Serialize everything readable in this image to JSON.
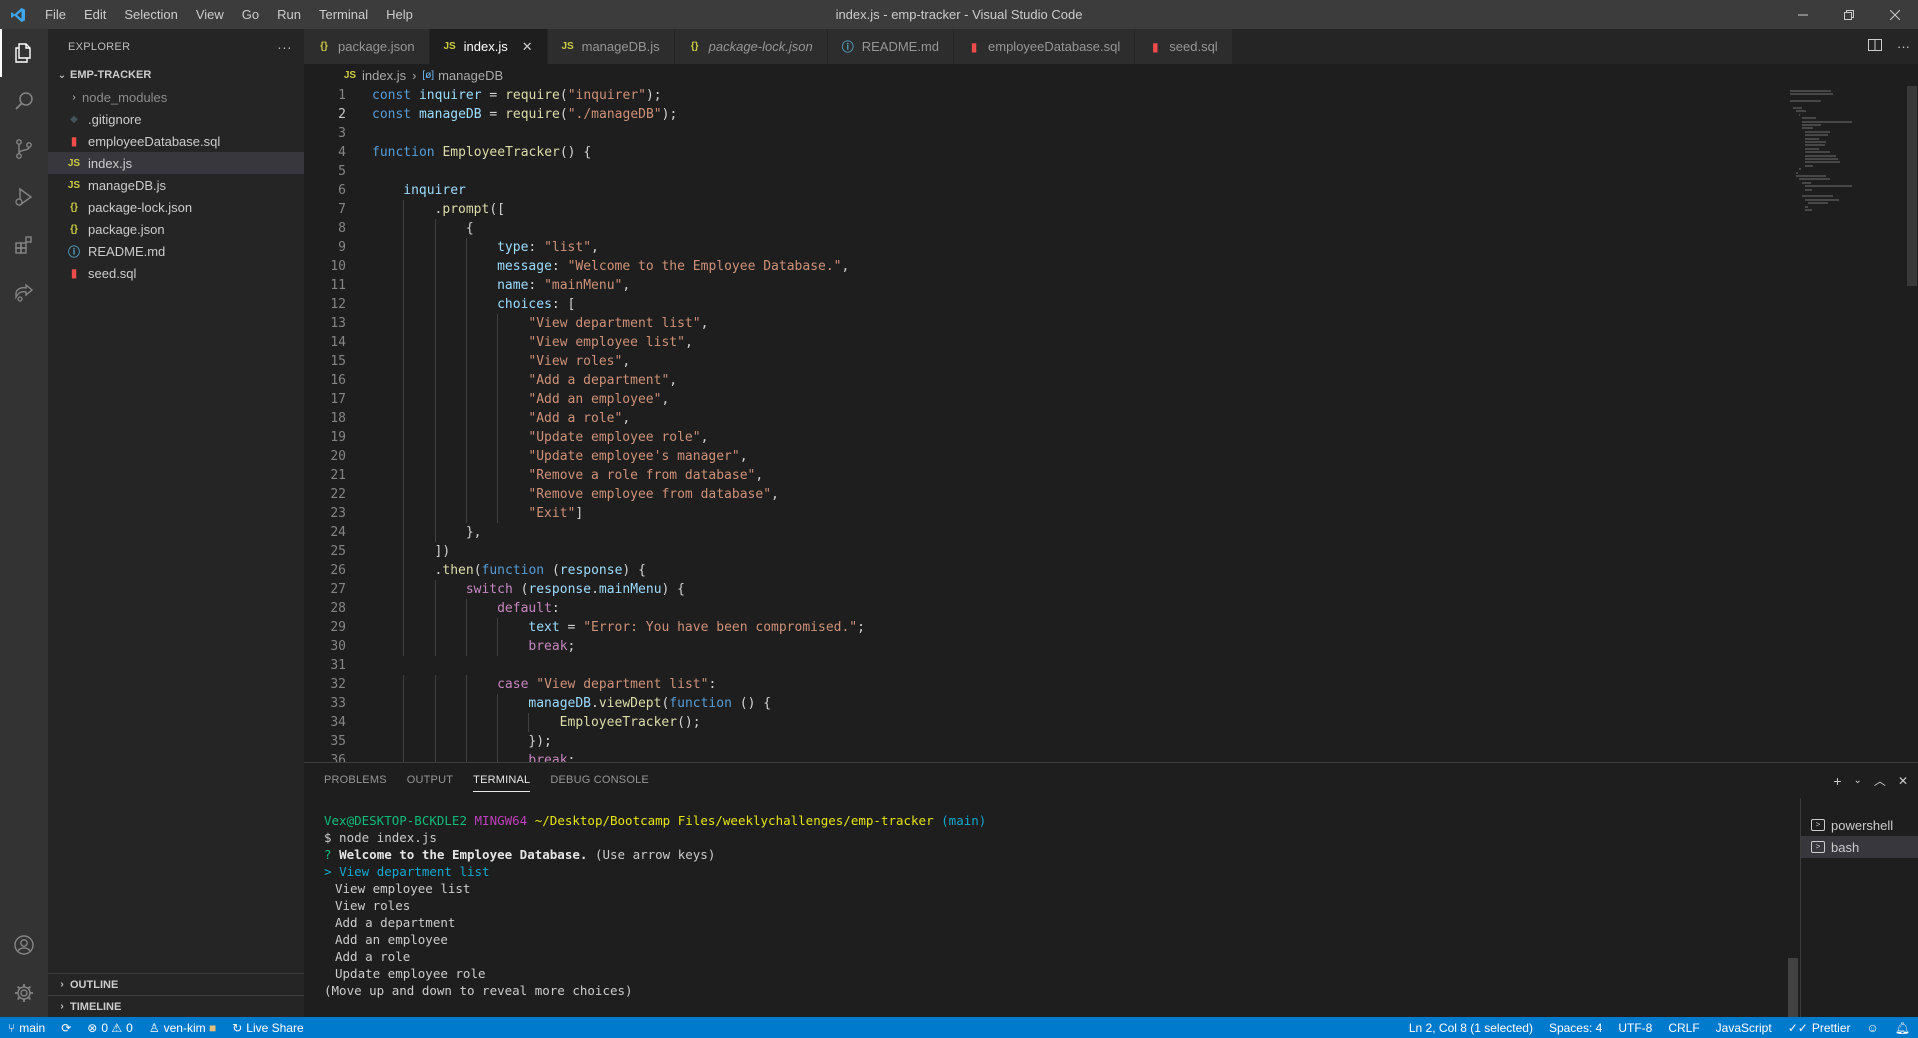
{
  "window": {
    "title": "index.js - emp-tracker - Visual Studio Code",
    "menu": [
      "File",
      "Edit",
      "Selection",
      "View",
      "Go",
      "Run",
      "Terminal",
      "Help"
    ]
  },
  "sidebar": {
    "header": "EXPLORER",
    "project": "EMP-TRACKER",
    "files": [
      {
        "name": "node_modules",
        "icon": "folder-icon"
      },
      {
        "name": ".gitignore",
        "icon": "git-icon"
      },
      {
        "name": "employeeDatabase.sql",
        "icon": "database-icon"
      },
      {
        "name": "index.js",
        "icon": "js-file-icon"
      },
      {
        "name": "manageDB.js",
        "icon": "js-file-icon"
      },
      {
        "name": "package-lock.json",
        "icon": "json-file-icon"
      },
      {
        "name": "package.json",
        "icon": "json-file-icon"
      },
      {
        "name": "README.md",
        "icon": "info-icon"
      },
      {
        "name": "seed.sql",
        "icon": "database-icon"
      }
    ],
    "outline": "OUTLINE",
    "timeline": "TIMELINE"
  },
  "tabs": [
    {
      "label": "package.json",
      "type": "json"
    },
    {
      "label": "index.js",
      "type": "js",
      "active": true
    },
    {
      "label": "manageDB.js",
      "type": "js"
    },
    {
      "label": "package-lock.json",
      "type": "json"
    },
    {
      "label": "README.md",
      "type": "info"
    },
    {
      "label": "employeeDatabase.sql",
      "type": "sql"
    },
    {
      "label": "seed.sql",
      "type": "sql"
    }
  ],
  "breadcrumb": {
    "file": "index.js",
    "symbol": "manageDB"
  },
  "editor": {
    "current_line": 2,
    "lines": [
      {
        "n": "1",
        "ind": 0,
        "toks": [
          [
            "kw",
            "const "
          ],
          [
            "var",
            "inquirer"
          ],
          [
            "pl",
            " = "
          ],
          [
            "fn",
            "require"
          ],
          [
            "pl",
            "("
          ],
          [
            "str",
            "\"inquirer\""
          ],
          [
            "pl",
            ");"
          ]
        ]
      },
      {
        "n": "2",
        "ind": 0,
        "toks": [
          [
            "kw",
            "const "
          ],
          [
            "var",
            "manageDB"
          ],
          [
            "pl",
            " = "
          ],
          [
            "fn",
            "require"
          ],
          [
            "pl",
            "("
          ],
          [
            "str",
            "\"./manageDB\""
          ],
          [
            "pl",
            ");"
          ]
        ]
      },
      {
        "n": "3",
        "ind": 0,
        "toks": []
      },
      {
        "n": "4",
        "ind": 0,
        "toks": [
          [
            "kw",
            "function "
          ],
          [
            "fn",
            "EmployeeTracker"
          ],
          [
            "pl",
            "() {"
          ]
        ]
      },
      {
        "n": "5",
        "ind": 0,
        "toks": []
      },
      {
        "n": "6",
        "ind": 1,
        "toks": [
          [
            "var",
            "inquirer"
          ]
        ]
      },
      {
        "n": "7",
        "ind": 2,
        "toks": [
          [
            "pl",
            "."
          ],
          [
            "fn",
            "prompt"
          ],
          [
            "pl",
            "(["
          ]
        ]
      },
      {
        "n": "8",
        "ind": 3,
        "toks": [
          [
            "pl",
            "{"
          ]
        ]
      },
      {
        "n": "9",
        "ind": 4,
        "toks": [
          [
            "var",
            "type"
          ],
          [
            "pl",
            ": "
          ],
          [
            "str",
            "\"list\""
          ],
          [
            "pl",
            ","
          ]
        ]
      },
      {
        "n": "10",
        "ind": 4,
        "toks": [
          [
            "var",
            "message"
          ],
          [
            "pl",
            ": "
          ],
          [
            "str",
            "\"Welcome to the Employee Database.\""
          ],
          [
            "pl",
            ","
          ]
        ]
      },
      {
        "n": "11",
        "ind": 4,
        "toks": [
          [
            "var",
            "name"
          ],
          [
            "pl",
            ": "
          ],
          [
            "str",
            "\"mainMenu\""
          ],
          [
            "pl",
            ","
          ]
        ]
      },
      {
        "n": "12",
        "ind": 4,
        "toks": [
          [
            "var",
            "choices"
          ],
          [
            "pl",
            ": ["
          ]
        ]
      },
      {
        "n": "13",
        "ind": 5,
        "toks": [
          [
            "str",
            "\"View department list\""
          ],
          [
            "pl",
            ","
          ]
        ]
      },
      {
        "n": "14",
        "ind": 5,
        "toks": [
          [
            "str",
            "\"View employee list\""
          ],
          [
            "pl",
            ","
          ]
        ]
      },
      {
        "n": "15",
        "ind": 5,
        "toks": [
          [
            "str",
            "\"View roles\""
          ],
          [
            "pl",
            ","
          ]
        ]
      },
      {
        "n": "16",
        "ind": 5,
        "toks": [
          [
            "str",
            "\"Add a department\""
          ],
          [
            "pl",
            ","
          ]
        ]
      },
      {
        "n": "17",
        "ind": 5,
        "toks": [
          [
            "str",
            "\"Add an employee\""
          ],
          [
            "pl",
            ","
          ]
        ]
      },
      {
        "n": "18",
        "ind": 5,
        "toks": [
          [
            "str",
            "\"Add a role\""
          ],
          [
            "pl",
            ","
          ]
        ]
      },
      {
        "n": "19",
        "ind": 5,
        "toks": [
          [
            "str",
            "\"Update employee role\""
          ],
          [
            "pl",
            ","
          ]
        ]
      },
      {
        "n": "20",
        "ind": 5,
        "toks": [
          [
            "str",
            "\"Update employee's manager\""
          ],
          [
            "pl",
            ","
          ]
        ]
      },
      {
        "n": "21",
        "ind": 5,
        "toks": [
          [
            "str",
            "\"Remove a role from database\""
          ],
          [
            "pl",
            ","
          ]
        ]
      },
      {
        "n": "22",
        "ind": 5,
        "toks": [
          [
            "str",
            "\"Remove employee from database\""
          ],
          [
            "pl",
            ","
          ]
        ]
      },
      {
        "n": "23",
        "ind": 5,
        "toks": [
          [
            "str",
            "\"Exit\""
          ],
          [
            "pl",
            "]"
          ]
        ]
      },
      {
        "n": "24",
        "ind": 3,
        "toks": [
          [
            "pl",
            "},"
          ]
        ]
      },
      {
        "n": "25",
        "ind": 2,
        "toks": [
          [
            "pl",
            "])"
          ]
        ]
      },
      {
        "n": "26",
        "ind": 2,
        "toks": [
          [
            "pl",
            "."
          ],
          [
            "fn",
            "then"
          ],
          [
            "pl",
            "("
          ],
          [
            "kw",
            "function "
          ],
          [
            "pl",
            "("
          ],
          [
            "var",
            "response"
          ],
          [
            "pl",
            ") {"
          ]
        ]
      },
      {
        "n": "27",
        "ind": 3,
        "toks": [
          [
            "kw2",
            "switch "
          ],
          [
            "pl",
            "("
          ],
          [
            "var",
            "response"
          ],
          [
            "pl",
            "."
          ],
          [
            "var",
            "mainMenu"
          ],
          [
            "pl",
            ") {"
          ]
        ]
      },
      {
        "n": "28",
        "ind": 4,
        "toks": [
          [
            "kw2",
            "default"
          ],
          [
            "pl",
            ":"
          ]
        ]
      },
      {
        "n": "29",
        "ind": 5,
        "toks": [
          [
            "var",
            "text"
          ],
          [
            "pl",
            " = "
          ],
          [
            "str",
            "\"Error: You have been compromised.\""
          ],
          [
            "pl",
            ";"
          ]
        ]
      },
      {
        "n": "30",
        "ind": 5,
        "toks": [
          [
            "kw2",
            "break"
          ],
          [
            "pl",
            ";"
          ]
        ]
      },
      {
        "n": "31",
        "ind": 0,
        "toks": []
      },
      {
        "n": "32",
        "ind": 4,
        "toks": [
          [
            "kw2",
            "case "
          ],
          [
            "str",
            "\"View department list\""
          ],
          [
            "pl",
            ":"
          ]
        ]
      },
      {
        "n": "33",
        "ind": 5,
        "toks": [
          [
            "var",
            "manageDB"
          ],
          [
            "pl",
            "."
          ],
          [
            "fn",
            "viewDept"
          ],
          [
            "pl",
            "("
          ],
          [
            "kw",
            "function "
          ],
          [
            "pl",
            "() {"
          ]
        ]
      },
      {
        "n": "34",
        "ind": 6,
        "toks": [
          [
            "fn",
            "EmployeeTracker"
          ],
          [
            "pl",
            "();"
          ]
        ]
      },
      {
        "n": "35",
        "ind": 5,
        "toks": [
          [
            "pl",
            "});"
          ]
        ]
      },
      {
        "n": "36",
        "ind": 5,
        "toks": [
          [
            "kw2",
            "break"
          ],
          [
            "pl",
            ";"
          ]
        ]
      }
    ]
  },
  "panel": {
    "tabs": [
      "PROBLEMS",
      "OUTPUT",
      "TERMINAL",
      "DEBUG CONSOLE"
    ],
    "active_tab": "TERMINAL",
    "terminal": {
      "prompt_user": "Vex@DESKTOP-BCKDLE2",
      "prompt_env": "MINGW64",
      "prompt_path": "~/Desktop/Bootcamp Files/weeklychallenges/emp-tracker",
      "prompt_branch": "(main)",
      "command": "$ node index.js",
      "question_mark": "?",
      "question": "Welcome to the Employee Database.",
      "question_hint": "(Use arrow keys)",
      "pointer": ">",
      "selected": "View department list",
      "choices": [
        "View employee list",
        "View roles",
        "Add a department",
        "Add an employee",
        "Add a role",
        "Update employee role"
      ],
      "footer": "(Move up and down to reveal more choices)"
    },
    "shells": [
      "powershell",
      "bash"
    ],
    "active_shell": "bash"
  },
  "statusbar": {
    "branch": "main",
    "errors": "0",
    "warnings": "0",
    "user": "ven-kim",
    "live_share": "Live Share",
    "position": "Ln 2, Col 8 (1 selected)",
    "spaces": "Spaces: 4",
    "encoding": "UTF-8",
    "eol": "CRLF",
    "language": "JavaScript",
    "formatter": "Prettier"
  },
  "colors": {
    "accent": "#007acc",
    "activity_bar": "#333333",
    "sidebar": "#252526",
    "editor_bg": "#1e1e1e"
  }
}
